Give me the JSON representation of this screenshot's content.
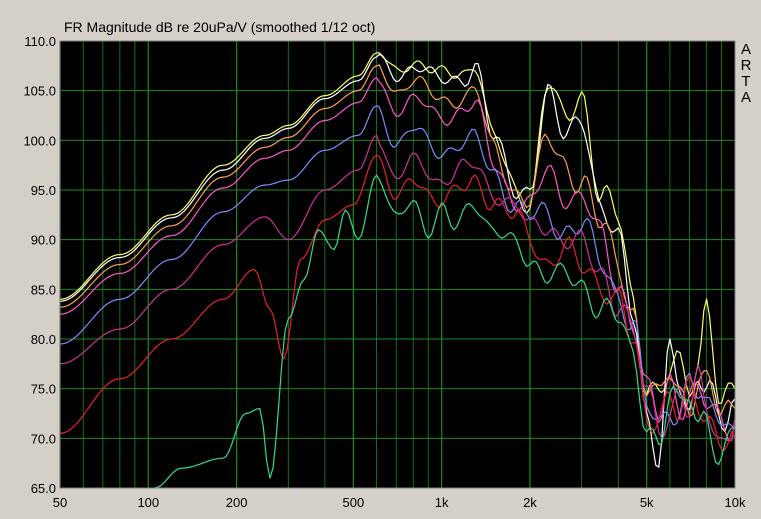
{
  "chart_data": {
    "type": "line",
    "title": "FR Magnitude dB re 20uPa/V (smoothed 1/12 oct)",
    "brand": [
      "A",
      "R",
      "T",
      "A"
    ],
    "xscale": "log",
    "xlim": [
      50,
      10000
    ],
    "ylim": [
      65,
      110
    ],
    "x_ticks": [
      {
        "v": 50,
        "label": "50"
      },
      {
        "v": 100,
        "label": "100"
      },
      {
        "v": 200,
        "label": "200"
      },
      {
        "v": 500,
        "label": "500"
      },
      {
        "v": 1000,
        "label": "1k"
      },
      {
        "v": 2000,
        "label": "2k"
      },
      {
        "v": 5000,
        "label": "5k"
      },
      {
        "v": 10000,
        "label": "10k"
      }
    ],
    "y_ticks": [
      {
        "v": 110,
        "label": "110.0"
      },
      {
        "v": 105,
        "label": "105.0"
      },
      {
        "v": 100,
        "label": "100.0"
      },
      {
        "v": 95,
        "label": "95.0"
      },
      {
        "v": 90,
        "label": "90.0"
      },
      {
        "v": 85,
        "label": "85.0"
      },
      {
        "v": 80,
        "label": "80.0"
      },
      {
        "v": 75,
        "label": "75.0"
      },
      {
        "v": 70,
        "label": "70.0"
      },
      {
        "v": 65,
        "label": "65.0"
      }
    ],
    "grid": true,
    "background": "#000000",
    "grid_color": "#1e8a1e",
    "series": [
      {
        "color": "#ffff66",
        "points": [
          [
            50,
            84
          ],
          [
            80,
            88.5
          ],
          [
            120,
            92.5
          ],
          [
            180,
            97.5
          ],
          [
            250,
            100.5
          ],
          [
            300,
            101.5
          ],
          [
            400,
            104.5
          ],
          [
            520,
            106.5
          ],
          [
            600,
            108.8
          ],
          [
            700,
            107
          ],
          [
            800,
            108
          ],
          [
            1000,
            106.5
          ],
          [
            1200,
            107
          ],
          [
            1300,
            108
          ],
          [
            1500,
            100
          ],
          [
            1800,
            95
          ],
          [
            2000,
            94
          ],
          [
            2300,
            105.5
          ],
          [
            2600,
            102
          ],
          [
            3000,
            105
          ],
          [
            3500,
            94
          ],
          [
            4000,
            92
          ],
          [
            4500,
            84
          ],
          [
            5000,
            76
          ],
          [
            5500,
            74
          ],
          [
            6000,
            76
          ],
          [
            6500,
            77
          ],
          [
            7000,
            76
          ],
          [
            7500,
            78
          ],
          [
            8000,
            84.5
          ],
          [
            9000,
            72
          ],
          [
            10000,
            75
          ]
        ]
      },
      {
        "color": "#ffffff",
        "points": [
          [
            50,
            83.8
          ],
          [
            80,
            88.2
          ],
          [
            120,
            92.2
          ],
          [
            180,
            97
          ],
          [
            250,
            100.2
          ],
          [
            300,
            101.2
          ],
          [
            400,
            104.2
          ],
          [
            520,
            106
          ],
          [
            600,
            108.4
          ],
          [
            700,
            106.5
          ],
          [
            800,
            107.5
          ],
          [
            1000,
            106
          ],
          [
            1200,
            106.5
          ],
          [
            1300,
            107.5
          ],
          [
            1500,
            100
          ],
          [
            1800,
            95.5
          ],
          [
            2000,
            95
          ],
          [
            2300,
            104
          ],
          [
            2600,
            101
          ],
          [
            3000,
            103
          ],
          [
            3500,
            92
          ],
          [
            4000,
            90
          ],
          [
            4500,
            84
          ],
          [
            5000,
            72
          ],
          [
            5500,
            67
          ],
          [
            6000,
            78
          ],
          [
            6500,
            76
          ],
          [
            7000,
            73
          ],
          [
            7500,
            77
          ],
          [
            8000,
            76
          ],
          [
            9000,
            70
          ],
          [
            10000,
            74
          ]
        ]
      },
      {
        "color": "#ff9e4a",
        "points": [
          [
            50,
            83.2
          ],
          [
            80,
            87.5
          ],
          [
            120,
            91.4
          ],
          [
            180,
            96.3
          ],
          [
            250,
            99.3
          ],
          [
            300,
            100.3
          ],
          [
            400,
            103.2
          ],
          [
            520,
            105
          ],
          [
            600,
            107.5
          ],
          [
            700,
            105
          ],
          [
            800,
            106
          ],
          [
            1000,
            104
          ],
          [
            1200,
            104.5
          ],
          [
            1300,
            105
          ],
          [
            1500,
            99
          ],
          [
            1800,
            95
          ],
          [
            2000,
            94
          ],
          [
            2300,
            100
          ],
          [
            2600,
            98
          ],
          [
            3000,
            96
          ],
          [
            3500,
            91
          ],
          [
            4000,
            88
          ],
          [
            4500,
            83
          ],
          [
            5000,
            75
          ],
          [
            5500,
            73
          ],
          [
            6000,
            77
          ],
          [
            6500,
            75
          ],
          [
            7000,
            74
          ],
          [
            7500,
            76
          ],
          [
            8000,
            75
          ],
          [
            9000,
            72
          ],
          [
            10000,
            73
          ]
        ]
      },
      {
        "color": "#ff55cc",
        "points": [
          [
            50,
            82.5
          ],
          [
            80,
            86.6
          ],
          [
            120,
            90.4
          ],
          [
            180,
            95.2
          ],
          [
            250,
            98.2
          ],
          [
            300,
            99
          ],
          [
            400,
            102
          ],
          [
            520,
            103.8
          ],
          [
            600,
            106.3
          ],
          [
            700,
            103
          ],
          [
            800,
            104
          ],
          [
            1000,
            102.5
          ],
          [
            1200,
            103
          ],
          [
            1300,
            103.5
          ],
          [
            1500,
            98
          ],
          [
            1800,
            94
          ],
          [
            2000,
            93
          ],
          [
            2300,
            97
          ],
          [
            2600,
            95
          ],
          [
            3000,
            94
          ],
          [
            3500,
            90
          ],
          [
            4000,
            86
          ],
          [
            4500,
            82
          ],
          [
            5000,
            74
          ],
          [
            5500,
            72
          ],
          [
            6000,
            76
          ],
          [
            6500,
            74
          ],
          [
            7000,
            75
          ],
          [
            7500,
            74
          ],
          [
            8000,
            73
          ],
          [
            9000,
            71
          ],
          [
            10000,
            72
          ]
        ]
      },
      {
        "color": "#7b8cff",
        "points": [
          [
            50,
            79.5
          ],
          [
            80,
            84
          ],
          [
            120,
            88
          ],
          [
            180,
            92.8
          ],
          [
            250,
            95.5
          ],
          [
            300,
            96
          ],
          [
            400,
            99
          ],
          [
            520,
            100.5
          ],
          [
            600,
            103.5
          ],
          [
            700,
            99.5
          ],
          [
            800,
            101
          ],
          [
            1000,
            99
          ],
          [
            1200,
            99.5
          ],
          [
            1300,
            100
          ],
          [
            1500,
            97
          ],
          [
            1800,
            93
          ],
          [
            2000,
            92
          ],
          [
            2300,
            93
          ],
          [
            2600,
            91
          ],
          [
            3000,
            91
          ],
          [
            3500,
            88
          ],
          [
            4000,
            85
          ],
          [
            4500,
            81
          ],
          [
            5000,
            73
          ],
          [
            5500,
            71
          ],
          [
            6000,
            74
          ],
          [
            6500,
            73
          ],
          [
            7000,
            76
          ],
          [
            7500,
            74
          ],
          [
            8000,
            72
          ],
          [
            9000,
            73
          ],
          [
            10000,
            71
          ]
        ]
      },
      {
        "color": "#cc3399",
        "points": [
          [
            50,
            77.5
          ],
          [
            80,
            81
          ],
          [
            120,
            85
          ],
          [
            180,
            89.5
          ],
          [
            250,
            92.3
          ],
          [
            300,
            90
          ],
          [
            400,
            95
          ],
          [
            520,
            97
          ],
          [
            600,
            100.5
          ],
          [
            700,
            96
          ],
          [
            800,
            98
          ],
          [
            1000,
            96
          ],
          [
            1200,
            97
          ],
          [
            1300,
            97.5
          ],
          [
            1500,
            95
          ],
          [
            1800,
            93
          ],
          [
            2000,
            91
          ],
          [
            2300,
            92
          ],
          [
            2600,
            90
          ],
          [
            3000,
            89
          ],
          [
            3500,
            87
          ],
          [
            4000,
            84
          ],
          [
            4500,
            80
          ],
          [
            5000,
            74
          ],
          [
            5500,
            72
          ],
          [
            6000,
            73
          ],
          [
            6500,
            75
          ],
          [
            7000,
            72
          ],
          [
            7500,
            75
          ],
          [
            8000,
            73
          ],
          [
            9000,
            70
          ],
          [
            10000,
            72
          ]
        ]
      },
      {
        "color": "#e8202a",
        "points": [
          [
            50,
            70.5
          ],
          [
            80,
            76
          ],
          [
            120,
            80
          ],
          [
            180,
            84
          ],
          [
            230,
            87
          ],
          [
            260,
            83
          ],
          [
            290,
            78
          ],
          [
            330,
            88
          ],
          [
            400,
            92
          ],
          [
            500,
            93.5
          ],
          [
            600,
            98.5
          ],
          [
            700,
            94
          ],
          [
            800,
            96
          ],
          [
            1000,
            94
          ],
          [
            1200,
            95
          ],
          [
            1300,
            96
          ],
          [
            1500,
            94
          ],
          [
            1800,
            92
          ],
          [
            2000,
            90
          ],
          [
            2300,
            88
          ],
          [
            2600,
            89
          ],
          [
            3000,
            87
          ],
          [
            3500,
            86
          ],
          [
            4000,
            84
          ],
          [
            4500,
            79
          ],
          [
            5000,
            72
          ],
          [
            5500,
            73
          ],
          [
            6000,
            75
          ],
          [
            6500,
            72
          ],
          [
            7000,
            74
          ],
          [
            7500,
            73
          ],
          [
            8000,
            72
          ],
          [
            9000,
            71
          ],
          [
            10000,
            70
          ]
        ]
      },
      {
        "color": "#33dd88",
        "points": [
          [
            105,
            65
          ],
          [
            130,
            67
          ],
          [
            180,
            68
          ],
          [
            215,
            72.5
          ],
          [
            240,
            73
          ],
          [
            260,
            66
          ],
          [
            300,
            82
          ],
          [
            340,
            86
          ],
          [
            380,
            91
          ],
          [
            430,
            89
          ],
          [
            470,
            93
          ],
          [
            520,
            90
          ],
          [
            600,
            96.5
          ],
          [
            700,
            92
          ],
          [
            800,
            94
          ],
          [
            900,
            91
          ],
          [
            1000,
            93
          ],
          [
            1100,
            91
          ],
          [
            1300,
            94
          ],
          [
            1500,
            91
          ],
          [
            1800,
            89
          ],
          [
            2000,
            88
          ],
          [
            2300,
            87
          ],
          [
            2600,
            86
          ],
          [
            3000,
            85
          ],
          [
            3500,
            84
          ],
          [
            4000,
            82
          ],
          [
            4500,
            77
          ],
          [
            5000,
            72
          ],
          [
            5500,
            70
          ],
          [
            6000,
            75
          ],
          [
            6500,
            72
          ],
          [
            7000,
            74
          ],
          [
            7500,
            71
          ],
          [
            8000,
            73
          ],
          [
            9000,
            68
          ],
          [
            10000,
            71
          ]
        ]
      }
    ]
  }
}
